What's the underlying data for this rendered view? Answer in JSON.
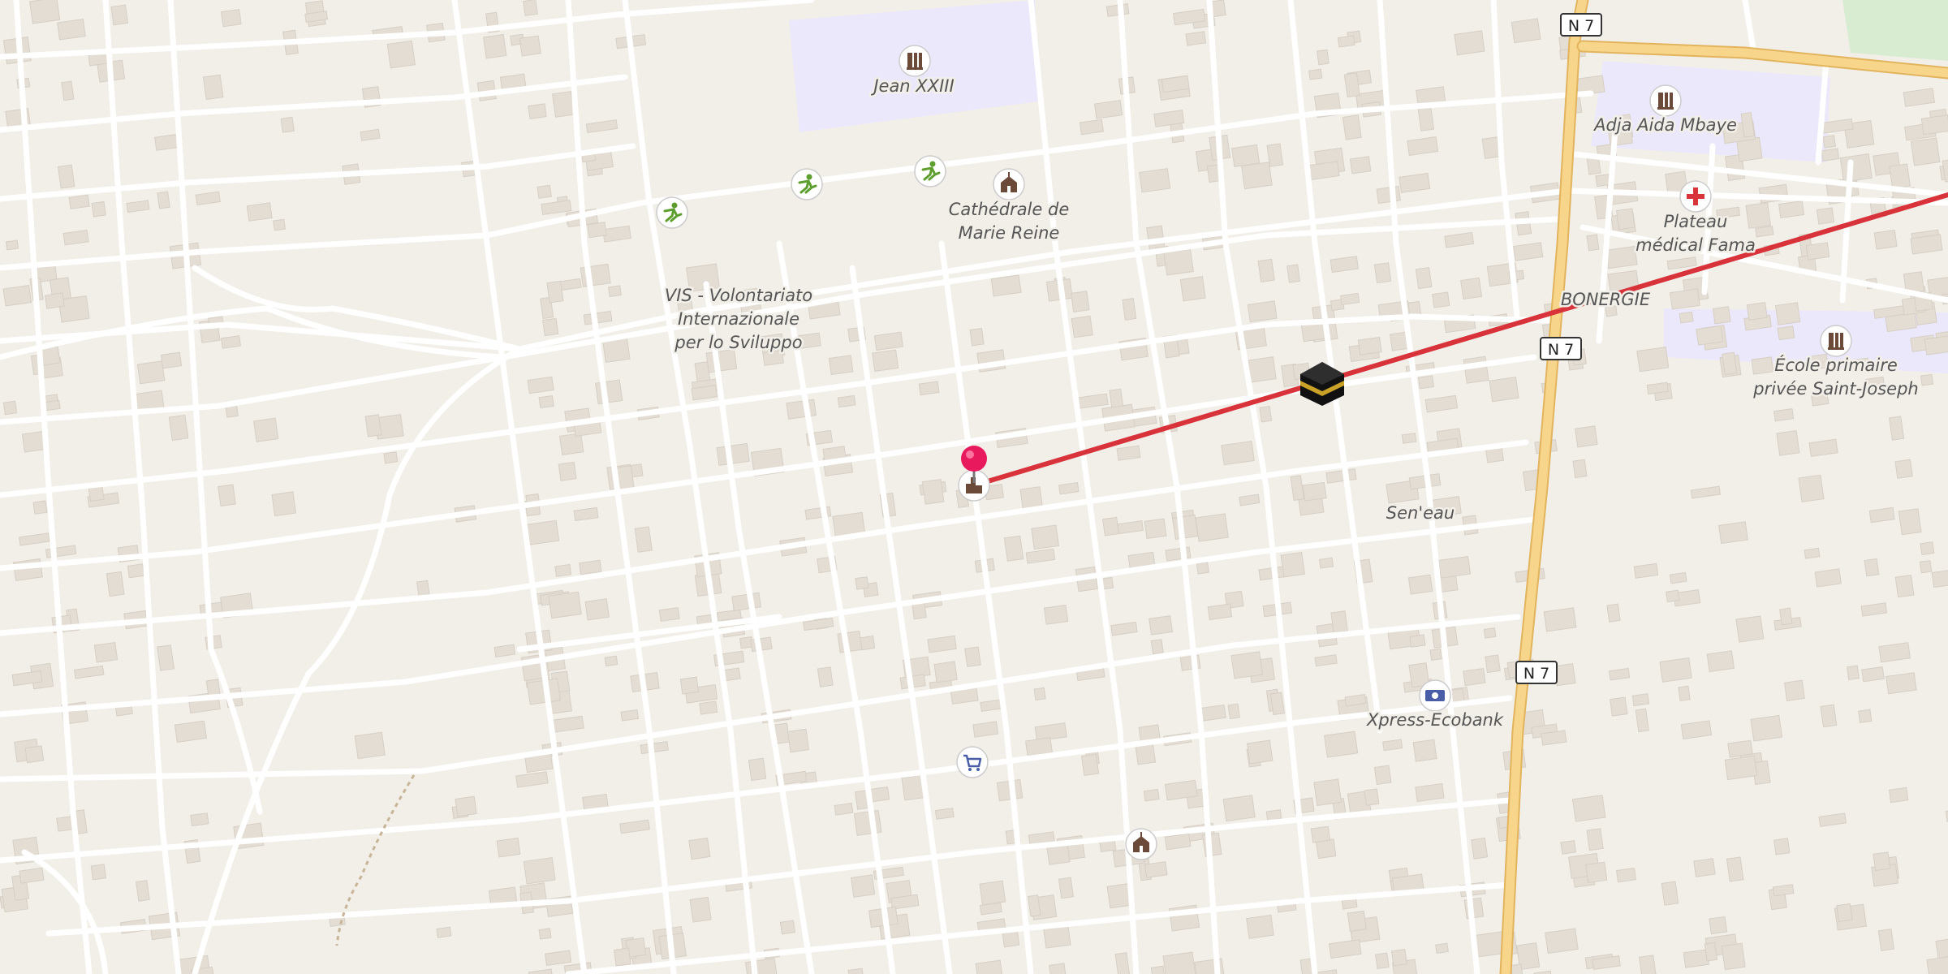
{
  "map": {
    "labels": {
      "jean_xxiii": "Jean XXIII",
      "cathedrale": [
        "Cathédrale de",
        "Marie Reine"
      ],
      "vis": [
        "VIS - Volontariato",
        "Internazionale",
        "per lo Sviluppo"
      ],
      "adja": "Adja Aida Mbaye",
      "plateau": [
        "Plateau",
        "médical Fama"
      ],
      "bonergie": "BONERGIE",
      "ecole": [
        "École primaire",
        "privée Saint-Joseph"
      ],
      "seneau": "Sen'eau",
      "xpress": "Xpress-Ecobank"
    },
    "road_shields": [
      "N 7",
      "N 7",
      "N 7"
    ],
    "colors": {
      "background": "#f2efe9",
      "road": "#ffffff",
      "primary_road": "#f7d58a",
      "primary_road_casing": "#e2b45e",
      "school_area": "#ece8fb",
      "park": "#d8ecd2",
      "route_line": "#d8323a",
      "pin": "#e8195d"
    },
    "icons": [
      "school-icon",
      "sports-icon",
      "church-icon",
      "hospital-icon",
      "mosque-icon",
      "location-pin-icon",
      "factory-icon",
      "bank-icon",
      "supermarket-icon",
      "kaaba-icon"
    ]
  }
}
